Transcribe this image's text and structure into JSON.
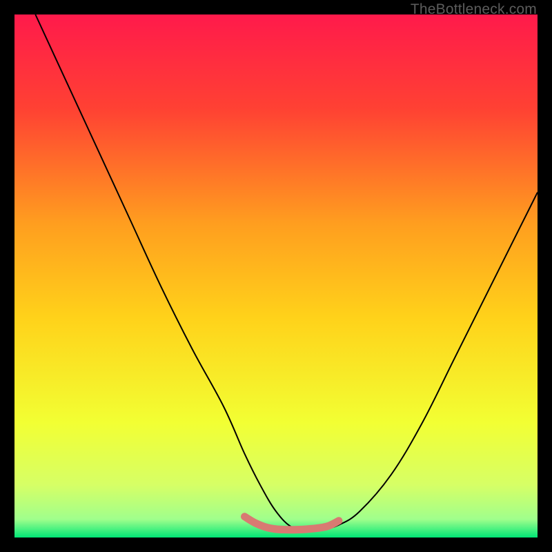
{
  "watermark": "TheBottleneck.com",
  "chart_data": {
    "type": "line",
    "title": "",
    "xlabel": "",
    "ylabel": "",
    "xlim": [
      0,
      100
    ],
    "ylim": [
      0,
      100
    ],
    "grid": false,
    "legend": false,
    "background_gradient": {
      "top_color": "#ff1a4b",
      "mid_color": "#ffe100",
      "bottom_color": "#00e676",
      "stops": [
        {
          "offset": 0.0,
          "color": "#ff1a4b"
        },
        {
          "offset": 0.18,
          "color": "#ff4133"
        },
        {
          "offset": 0.4,
          "color": "#ff9e1f"
        },
        {
          "offset": 0.58,
          "color": "#ffd21a"
        },
        {
          "offset": 0.78,
          "color": "#f2ff33"
        },
        {
          "offset": 0.9,
          "color": "#d6ff66"
        },
        {
          "offset": 0.965,
          "color": "#a0ff8c"
        },
        {
          "offset": 1.0,
          "color": "#00e676"
        }
      ]
    },
    "series": [
      {
        "name": "bottleneck-curve",
        "color": "#000000",
        "x": [
          4,
          10,
          16,
          22,
          28,
          34,
          40,
          44,
          47,
          50,
          53,
          56,
          59,
          62,
          66,
          72,
          78,
          84,
          90,
          96,
          100
        ],
        "values": [
          100,
          87,
          74,
          61,
          48,
          36,
          25,
          16,
          10,
          5,
          2,
          1.6,
          1.6,
          2.4,
          5,
          12,
          22,
          34,
          46,
          58,
          66
        ]
      },
      {
        "name": "plateau-marker",
        "color": "#d87a72",
        "x": [
          44,
          46,
          48,
          50,
          52,
          54,
          56,
          58,
          60,
          62
        ],
        "values": [
          4.0,
          2.8,
          2.0,
          1.6,
          1.5,
          1.5,
          1.6,
          1.8,
          2.2,
          3.2
        ]
      }
    ]
  }
}
